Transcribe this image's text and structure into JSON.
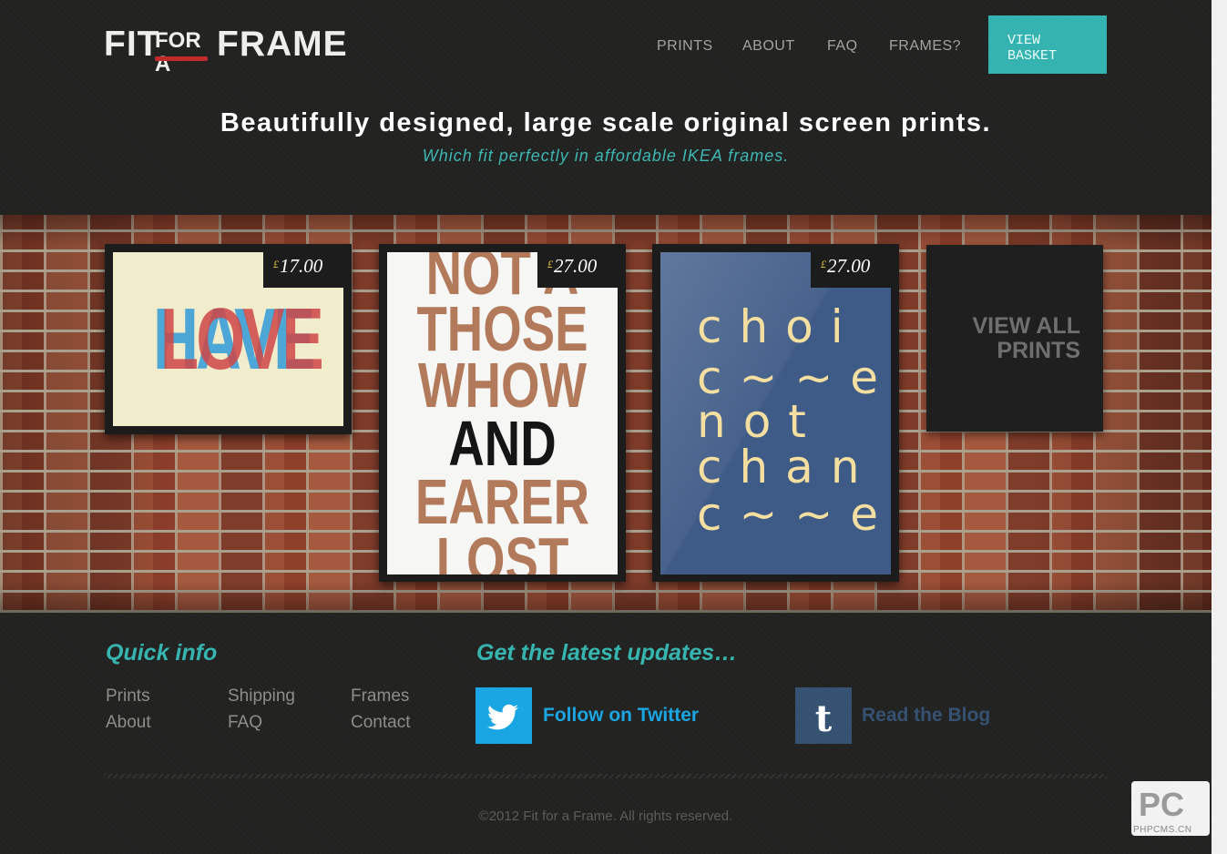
{
  "header": {
    "logo": {
      "word1": "FIT",
      "word2": "FOR A",
      "word3": "FRAME"
    },
    "nav": [
      {
        "label": "PRINTS"
      },
      {
        "label": "ABOUT"
      },
      {
        "label": "FAQ"
      },
      {
        "label": "FRAMES?"
      }
    ],
    "basket_label": "VIEW BASKET"
  },
  "hero": {
    "headline": "Beautifully designed, large scale original screen prints.",
    "subline": "Which fit perfectly in affordable IKEA frames."
  },
  "prints": [
    {
      "currency": "£",
      "price": "17.00",
      "art_text_a": "HAVE",
      "art_text_b": "LOVE"
    },
    {
      "currency": "£",
      "price": "27.00",
      "art_lines": [
        "NOT A",
        "THOSE",
        "WHOW",
        "AND",
        "EARER",
        "LOST"
      ]
    },
    {
      "currency": "£",
      "price": "27.00",
      "art_lines": [
        "choi",
        "c~~e",
        "not",
        "chan",
        "c~~e"
      ]
    }
  ],
  "view_all_label": "VIEW ALL PRINTS",
  "footer": {
    "quick_info_title": "Quick info",
    "quick_links": [
      {
        "label": "Prints"
      },
      {
        "label": "Shipping"
      },
      {
        "label": "Frames"
      },
      {
        "label": "About"
      },
      {
        "label": "FAQ"
      },
      {
        "label": "Contact"
      }
    ],
    "updates_title": "Get the latest updates…",
    "twitter_label": "Follow on Twitter",
    "blog_label": "Read the Blog",
    "copyright": "©2012 Fit for a Frame. All rights reserved."
  },
  "watermark": {
    "big": "PC",
    "small": "PHPCMS.CN"
  },
  "colors": {
    "accent": "#35b3b0",
    "twitter": "#1aa6e3",
    "tumblr": "#355273",
    "background": "#222221"
  },
  "icons": {
    "twitter": "twitter-bird-icon",
    "tumblr": "tumblr-t-icon"
  }
}
